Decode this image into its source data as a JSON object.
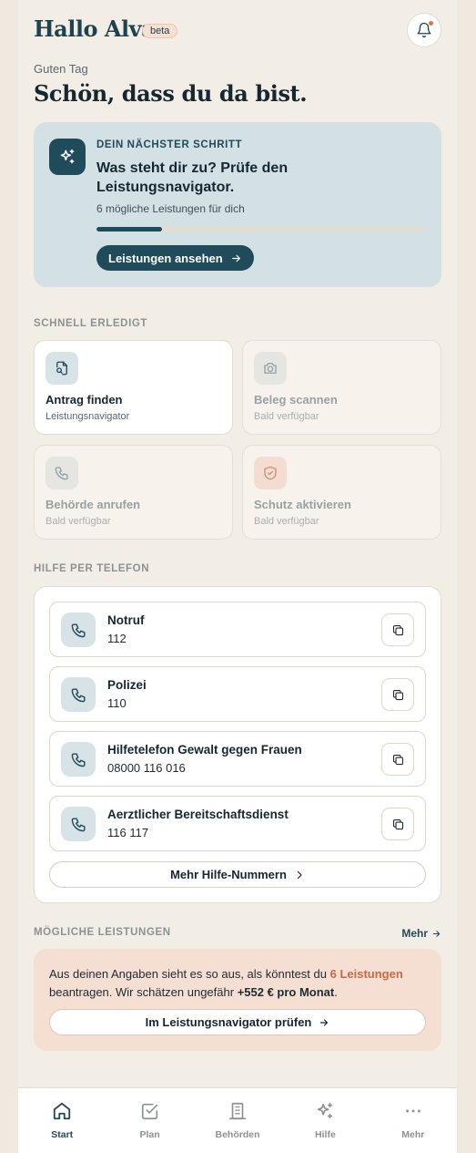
{
  "header": {
    "title": "Hallo Alva",
    "badge": "beta"
  },
  "greeting": {
    "sub": "Guten Tag",
    "headline": "Schön, dass du da bist."
  },
  "next_step": {
    "kicker": "DEIN NÄCHSTER SCHRITT",
    "title": "Was steht dir zu? Prüfe den Leistungsnavigator.",
    "meta": "6 mögliche Leistungen für dich",
    "progress": 0.2,
    "button_label": "Leistungen ansehen"
  },
  "quick": {
    "label": "SCHNELL ERLEDIGT",
    "tiles": [
      {
        "title": "Antrag finden",
        "sub": "Leistungsnavigator",
        "icon": "document-search-icon",
        "active": true
      },
      {
        "title": "Beleg scannen",
        "sub": "Bald verfügbar",
        "icon": "camera-icon",
        "active": false
      },
      {
        "title": "Behörde anrufen",
        "sub": "Bald verfügbar",
        "icon": "phone-icon",
        "active": false
      },
      {
        "title": "Schutz aktivieren",
        "sub": "Bald verfügbar",
        "icon": "shield-icon",
        "active": false
      }
    ]
  },
  "help": {
    "label": "HILFE PER TELEFON",
    "numbers": [
      {
        "name": "Notruf",
        "number": "112"
      },
      {
        "name": "Polizei",
        "number": "110"
      },
      {
        "name": "Hilfetelefon Gewalt gegen Frauen",
        "number": "08000 116 016"
      },
      {
        "name": "Aerztlicher Bereitschaftsdienst",
        "number": "116 117"
      }
    ],
    "more_label": "Mehr Hilfe-Nummern"
  },
  "benefits": {
    "label": "MÖGLICHE LEISTUNGEN",
    "more_link": "Mehr",
    "text_before": "Aus deinen Angaben sieht es so aus, als könntest du ",
    "count_text": "6 Leistungen",
    "text_middle": " beantragen. Wir schätzen ungefähr ",
    "amount_text": "+552 € pro Monat",
    "text_after": ".",
    "button_label": "Im Leistungsnavigator prüfen"
  },
  "nav": {
    "items": [
      {
        "label": "Start",
        "icon": "home-icon",
        "active": true
      },
      {
        "label": "Plan",
        "icon": "checklist-icon",
        "active": false
      },
      {
        "label": "Behörden",
        "icon": "building-icon",
        "active": false
      },
      {
        "label": "Hilfe",
        "icon": "sparkle-icon",
        "active": false
      },
      {
        "label": "Mehr",
        "icon": "more-dots-icon",
        "active": false
      }
    ]
  },
  "colors": {
    "primary": "#1f4b5a",
    "accent": "#c96a45",
    "background": "#f3eee5",
    "next_card": "#d3e1e4",
    "benefit_card": "#f5dfd2"
  }
}
